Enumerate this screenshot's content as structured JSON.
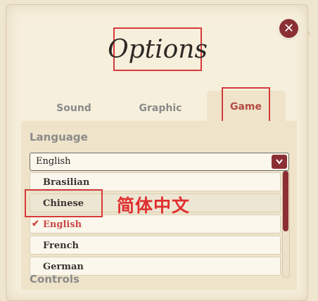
{
  "dialog": {
    "title": "Options",
    "close_symbol": "✕"
  },
  "tabs": [
    {
      "label": "Sound"
    },
    {
      "label": "Graphic"
    },
    {
      "label": "Game"
    }
  ],
  "game": {
    "language_label": "Language",
    "controls_label": "Controls",
    "language_select": {
      "selected": "English",
      "arrow_icon": "chevron-down-icon"
    },
    "language_options": [
      {
        "label": "Brasilian"
      },
      {
        "label": "Chinese"
      },
      {
        "label": "English",
        "selected": true
      },
      {
        "label": "French"
      },
      {
        "label": "German"
      }
    ]
  },
  "annotation": {
    "text": "简体中文"
  },
  "colors": {
    "accent": "#8b2f35",
    "selected_text": "#c94a47",
    "highlight_box": "#d63a3a",
    "background": "#efe6cf"
  }
}
